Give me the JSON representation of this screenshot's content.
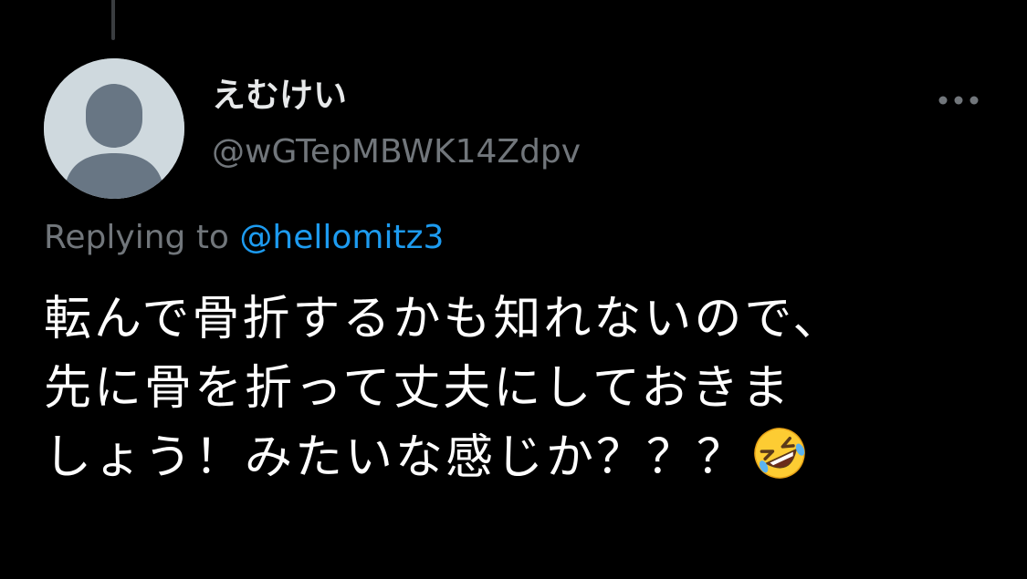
{
  "user": {
    "display_name": "えむけい",
    "handle": "@wGTepMBWK14Zdpv",
    "avatar_color": "#cfd9de",
    "avatar_silhouette_color": "#687684"
  },
  "reply": {
    "prefix": "Replying to ",
    "mention": "@hellomitz3",
    "mention_color": "#1d9bf0"
  },
  "tweet": {
    "lines": [
      "転んで骨折するかも知れないので、",
      "先に骨を折って丈夫にしておきま",
      "しょう！みたいな感じか？？？"
    ],
    "trailing_emoji": "rolling-on-the-floor-laughing-emoji"
  },
  "icons": {
    "more": "more-horizontal-icon"
  },
  "colors": {
    "background": "#000000",
    "primary_text": "#e7e9ea",
    "secondary_text": "#71767b"
  }
}
